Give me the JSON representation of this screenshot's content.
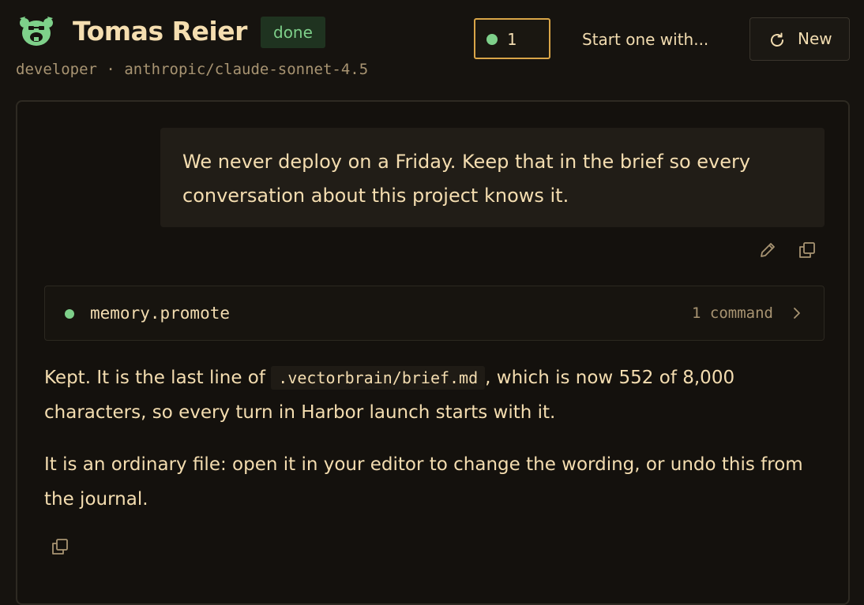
{
  "header": {
    "agent_name": "Tomas Reier",
    "status": "done",
    "role": "developer",
    "separator": "·",
    "model": "anthropic/claude-sonnet-4.5",
    "active_count": "1",
    "start_link": "Start one with...",
    "new_button_label": "New"
  },
  "conversation": {
    "user_message": "We never deploy on a Friday. Keep that in the brief so every conversation about this project knows it.",
    "tool_call": {
      "name": "memory.promote",
      "count_label": "1 command"
    },
    "assistant": {
      "p1_before": "Kept. It is the last line of ",
      "p1_code": ".vectorbrain/brief.md",
      "p1_after": ", which is now 552 of 8,000 characters, so every turn in Harbor launch starts with it.",
      "p2": "It is an ordinary file: open it in your editor to change the wording, or undo this from the journal."
    }
  },
  "icons": {
    "logo": "bear-mascot-icon",
    "new": "refresh-icon",
    "edit": "pencil-icon",
    "copy": "copy-icon",
    "expand": "chevron-right-icon"
  },
  "colors": {
    "background": "#16130f",
    "accent": "#d9a548",
    "success": "#7ed08a",
    "text": "#f2dcb0",
    "muted": "#a89472"
  }
}
